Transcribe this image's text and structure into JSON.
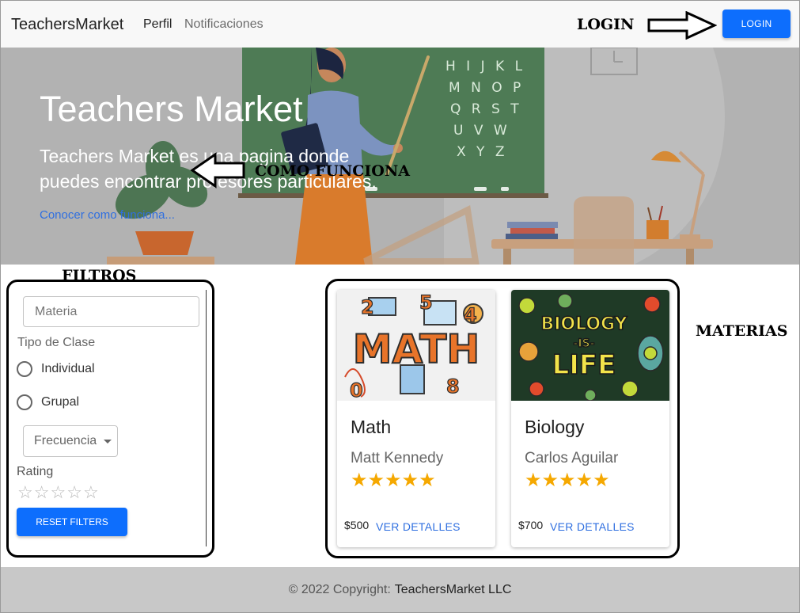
{
  "navbar": {
    "brand": "TeachersMarket",
    "links": [
      "Perfil",
      "Notificaciones"
    ],
    "login_label": "LOGIN"
  },
  "hero": {
    "title": "Teachers Market",
    "description": "Teachers Market es una pagina donde puedes encontrar profesores particulares.",
    "link_label": "Conocer como funciona...",
    "board_letters": [
      "H I J K L",
      "M N O P",
      "Q R S T",
      "U V W",
      "X Y Z"
    ]
  },
  "annotations": {
    "login": "LOGIN",
    "como_funciona": "COMO FUNCIONA",
    "filtros": "FILTROS",
    "materias": "MATERIAS"
  },
  "filters": {
    "materia_placeholder": "Materia",
    "tipo_label": "Tipo de Clase",
    "options": [
      "Individual",
      "Grupal"
    ],
    "frecuencia_label": "Frecuencia",
    "rating_label": "Rating",
    "rating_value": 0,
    "reset_label": "RESET FILTERS"
  },
  "cards": [
    {
      "subject": "Math",
      "teacher": "Matt Kennedy",
      "rating": 5,
      "price": "$500",
      "details_label": "VER DETALLES",
      "image_text": "MATH"
    },
    {
      "subject": "Biology",
      "teacher": "Carlos Aguilar",
      "rating": 5,
      "price": "$700",
      "details_label": "VER DETALLES",
      "image_text_lines": [
        "BIOLOGY",
        "-IS-",
        "LIFE"
      ]
    }
  ],
  "footer": {
    "copyright": "© 2022 Copyright:",
    "owner": "TeachersMarket LLC"
  },
  "colors": {
    "primary": "#0d6efd",
    "link": "#2f6fe0",
    "star": "#f5a800",
    "hero_bg": "#b2b2b2",
    "footer_bg": "#c8c8c8"
  }
}
